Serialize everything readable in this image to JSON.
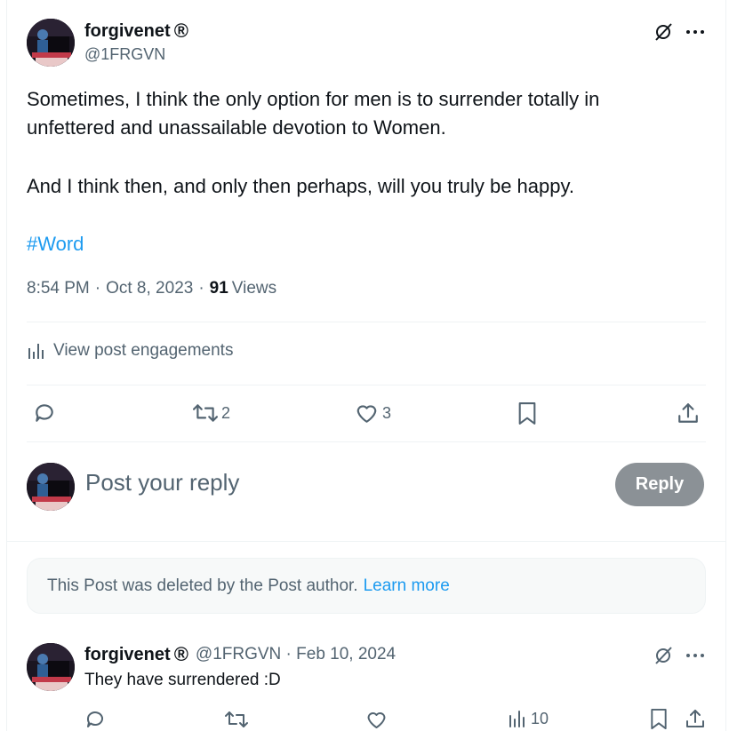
{
  "post": {
    "display_name": "forgivenet",
    "badge": "®",
    "handle": "@1FRGVN",
    "text_line1": "Sometimes, I think the only option for men is to surrender totally in",
    "text_line2": "unfettered and unassailable devotion to Women.",
    "text_line3": "And I think then, and only then perhaps, will you truly be happy.",
    "hashtag": "#Word",
    "time": "8:54 PM",
    "date": "Oct 8, 2023",
    "separator": "·",
    "views_count": "91",
    "views_label": "Views",
    "engagements_label": "View post engagements",
    "retweet_count": "2",
    "like_count": "3"
  },
  "composer": {
    "placeholder": "Post your reply",
    "reply_button": "Reply"
  },
  "deleted_notice": {
    "text": "This Post was deleted by the Post author.",
    "link": "Learn more"
  },
  "reply": {
    "display_name": "forgivenet",
    "badge": "®",
    "meta": "@1FRGVN · Feb 10, 2024",
    "text": "They have surrendered :D",
    "views_count": "10"
  },
  "colors": {
    "accent": "#1d9bf0",
    "muted": "#536471",
    "reply_button_bg": "#8b9196"
  },
  "icons": [
    "grok-icon",
    "more-icon",
    "bar-chart-icon",
    "reply-icon",
    "retweet-icon",
    "like-icon",
    "bookmark-icon",
    "share-icon"
  ]
}
